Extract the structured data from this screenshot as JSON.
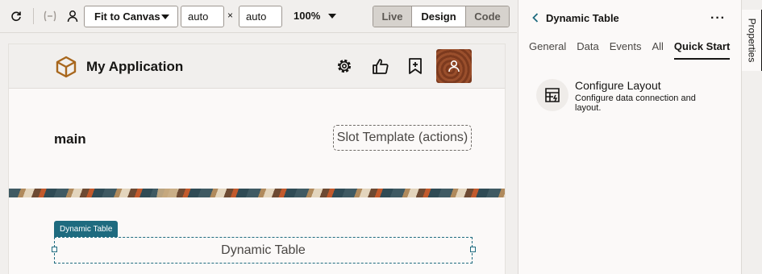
{
  "toolbar": {
    "fit_label": "Fit to Canvas",
    "width_value": "auto",
    "height_value": "auto",
    "times": "×",
    "zoom": "100%",
    "modes": [
      "Live",
      "Design",
      "Code"
    ],
    "active_mode": "Design"
  },
  "app": {
    "title": "My Application",
    "main_label": "main",
    "slot_label": "Slot Template (actions)",
    "component_tag": "Dynamic Table",
    "component_label": "Dynamic Table"
  },
  "panel": {
    "title": "Dynamic Table",
    "more": "···",
    "tabs": [
      "General",
      "Data",
      "Events",
      "All",
      "Quick Start"
    ],
    "active_tab": "Quick Start",
    "quick_start": {
      "title": "Configure Layout",
      "description": "Configure data connection and layout."
    }
  },
  "side_tab": "Properties",
  "colors": {
    "accent": "#1e6b7f",
    "logo": "#a8671d"
  }
}
